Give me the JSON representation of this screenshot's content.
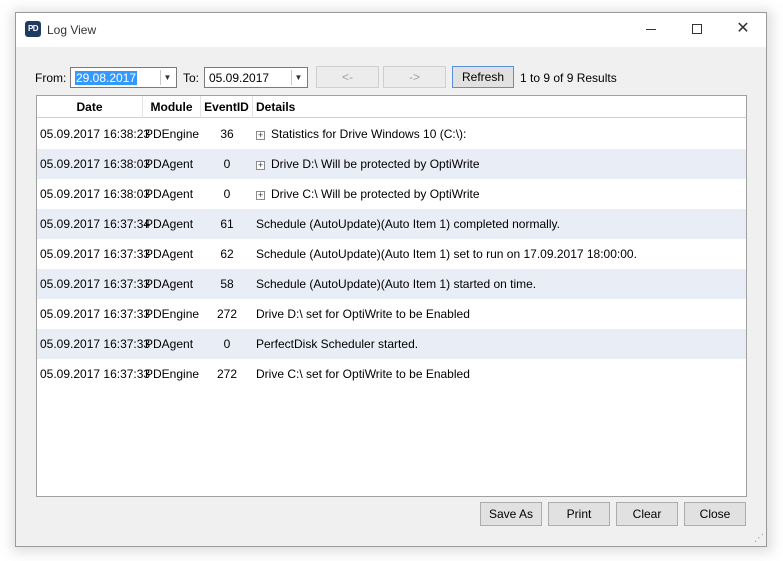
{
  "window": {
    "title": "Log View",
    "icon_text": "PD",
    "close_glyph": "✕"
  },
  "toolbar": {
    "from_label": "From:",
    "from_value": "29.08.2017",
    "to_label": "To:",
    "to_value": "05.09.2017",
    "prev_label": "<-",
    "next_label": "->",
    "refresh_label": "Refresh",
    "results_text": "1 to 9 of 9 Results"
  },
  "grid": {
    "columns": [
      "Date",
      "Module",
      "EventID",
      "Details"
    ],
    "rows": [
      {
        "date": "05.09.2017 16:38:23",
        "module": "PDEngine",
        "event_id": "36",
        "details": "Statistics for Drive Windows 10 (C:\\):",
        "expandable": true
      },
      {
        "date": "05.09.2017 16:38:03",
        "module": "PDAgent",
        "event_id": "0",
        "details": "Drive D:\\ Will be protected by OptiWrite",
        "expandable": true
      },
      {
        "date": "05.09.2017 16:38:03",
        "module": "PDAgent",
        "event_id": "0",
        "details": "Drive C:\\ Will be protected by OptiWrite",
        "expandable": true
      },
      {
        "date": "05.09.2017 16:37:34",
        "module": "PDAgent",
        "event_id": "61",
        "details": "Schedule (AutoUpdate)(Auto Item 1) completed normally.",
        "expandable": false
      },
      {
        "date": "05.09.2017 16:37:33",
        "module": "PDAgent",
        "event_id": "62",
        "details": "Schedule (AutoUpdate)(Auto Item 1) set to run on 17.09.2017 18:00:00.",
        "expandable": false
      },
      {
        "date": "05.09.2017 16:37:33",
        "module": "PDAgent",
        "event_id": "58",
        "details": "Schedule (AutoUpdate)(Auto Item 1) started on time.",
        "expandable": false
      },
      {
        "date": "05.09.2017 16:37:33",
        "module": "PDEngine",
        "event_id": "272",
        "details": "Drive D:\\ set for OptiWrite to be Enabled",
        "expandable": false
      },
      {
        "date": "05.09.2017 16:37:33",
        "module": "PDAgent",
        "event_id": "0",
        "details": "PerfectDisk Scheduler started.",
        "expandable": false
      },
      {
        "date": "05.09.2017 16:37:33",
        "module": "PDEngine",
        "event_id": "272",
        "details": "Drive C:\\ set for OptiWrite to be Enabled",
        "expandable": false
      }
    ]
  },
  "footer": {
    "save_as_label": "Save As",
    "print_label": "Print",
    "clear_label": "Clear",
    "close_label": "Close"
  },
  "colors": {
    "alt_row": "#e9edf6",
    "selection": "#3399ff"
  }
}
